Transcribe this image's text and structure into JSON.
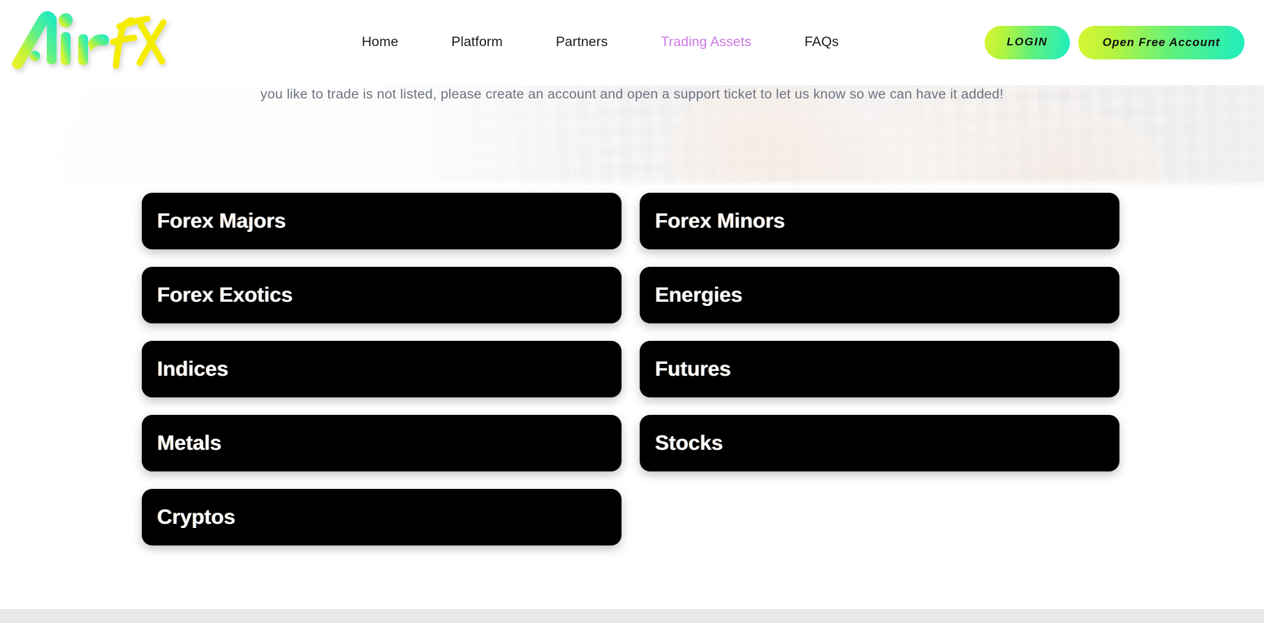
{
  "brand": {
    "name": "AirFX",
    "logo_air": "Air",
    "logo_fx": "FX",
    "gradient_start": "#e8f531",
    "gradient_end": "#1ae8c8",
    "fx_color": "#f5ed00"
  },
  "nav": {
    "items": [
      {
        "label": "Home",
        "active": false
      },
      {
        "label": "Platform",
        "active": false
      },
      {
        "label": "Partners",
        "active": false
      },
      {
        "label": "Trading Assets",
        "active": true
      },
      {
        "label": "FAQs",
        "active": false
      }
    ],
    "active_color": "#cc79e6",
    "default_color": "#1a1a1a"
  },
  "header_actions": {
    "login_label": "LOGIN",
    "open_account_label": "Open Free Account",
    "button_gradient_start": "#d8f531",
    "button_gradient_end": "#1ceec0"
  },
  "hero": {
    "paragraph": "you like to trade is not listed, please create an account and open a support ticket to let us know so we can have it added!",
    "text_color": "#6b7280"
  },
  "assets": {
    "card_bg": "#000000",
    "card_text": "#ffffff",
    "rows": [
      [
        {
          "label": "Forex Majors",
          "placeholder": false
        },
        {
          "label": "Forex Minors",
          "placeholder": false
        }
      ],
      [
        {
          "label": "Forex Exotics",
          "placeholder": false
        },
        {
          "label": "Energies",
          "placeholder": false
        }
      ],
      [
        {
          "label": "Indices",
          "placeholder": false
        },
        {
          "label": "Futures",
          "placeholder": false
        }
      ],
      [
        {
          "label": "Metals",
          "placeholder": false
        },
        {
          "label": "Stocks",
          "placeholder": false
        }
      ],
      [
        {
          "label": "Cryptos",
          "placeholder": false
        },
        {
          "label": "",
          "placeholder": true
        }
      ]
    ]
  },
  "footer": {
    "band_color": "#e8e8e8"
  }
}
